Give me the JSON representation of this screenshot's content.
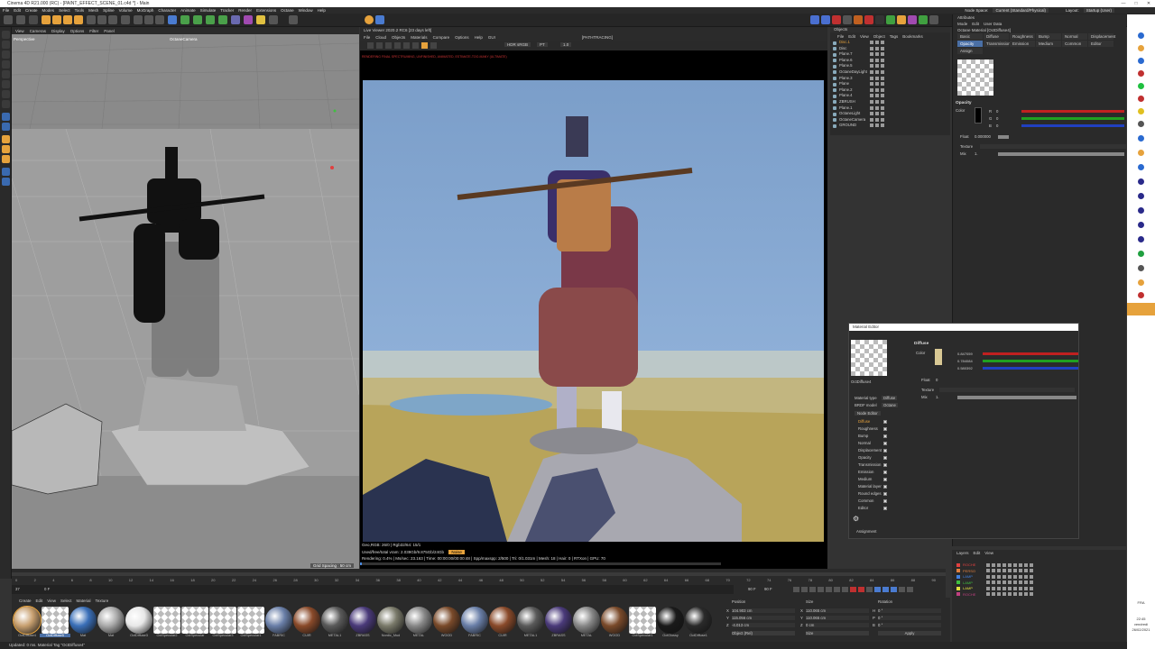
{
  "window": {
    "title": "Cinema 4D R21.000 (RC) - [PAINT_EFFECT_SCENE_01.c4d *] - Main",
    "controls": [
      "—",
      "□",
      "✕"
    ]
  },
  "menubar": {
    "items": [
      "File",
      "Edit",
      "Create",
      "Modes",
      "Select",
      "Tools",
      "Mesh",
      "Spline",
      "Volume",
      "MoGraph",
      "Character",
      "Animate",
      "Simulate",
      "Tracker",
      "Render",
      "Extensions",
      "Octane",
      "Window",
      "Help"
    ],
    "node_space_label": "Node Space:",
    "node_space_value": "Current (Standard/Physical)",
    "layout_label": "Layout:",
    "layout_value": "Startup (User)"
  },
  "viewport": {
    "menu": [
      "View",
      "Cameras",
      "Display",
      "Options",
      "Filter",
      "Panel"
    ],
    "label": "Perspective",
    "camera": "OctaneCamera",
    "grid_spacing": "Grid Spacing : 50 cm"
  },
  "live_viewer": {
    "title": "Live Viewer 2020.2 RC6 [23 days left]",
    "menu": [
      "File",
      "Cloud",
      "Objects",
      "Materials",
      "Compare",
      "Options",
      "Help",
      "GUI"
    ],
    "mode_label": "[PATHTRACING]",
    "hdr_value": "HDR sRGB",
    "pt_value": "PT",
    "zoom_value": "1.0",
    "warning": "RENDERING FINAL SPECTRUMING, UNFINISHED, ANIMATED, ESTIMATE-TOO-MANY (ULTIMATE)",
    "stats": [
      "Geo,RGB: 26/0 | Rgb32/64: 15/1",
      "Used/free/total vram: 2.039Gb/9.875Gb/24Gb",
      "Rendering: 0.4% | Ms/sec: 23.163 | Time: 00:00:00/00:00:48 | Spp/maxspp: 2/500 | Tri: 0/1.031m | Mesh: 18 | Hair: 0 | RTXon | GPU: 70"
    ],
    "noise_label": "Noise",
    "spp_progress": 0.004
  },
  "objects": {
    "title": "Objects",
    "menu": [
      "File",
      "Edit",
      "View",
      "Object",
      "Tags",
      "Bookmarks"
    ],
    "rows": [
      "Disc.1",
      "Disc",
      "Plane.7",
      "Plane.6",
      "Plane.5",
      "OctaneDayLight",
      "Plane.3",
      "Plane",
      "Plane.2",
      "Plane.4",
      "ZBRUSH",
      "Plane.1",
      "OctaneLight",
      "OctaneCamera",
      "GROUND"
    ]
  },
  "attributes": {
    "title": "Attributes",
    "menu": [
      "Mode",
      "Edit",
      "User Data"
    ],
    "material_name": "Octane Material [OctDiffuse4]",
    "tabs": [
      "Basic",
      "Diffuse",
      "Roughness",
      "Bump",
      "Normal",
      "Displacement",
      "Opacity",
      "Transmission",
      "Emission",
      "Medium",
      "Common",
      "Editor",
      "Assign"
    ],
    "active_tab": "Opacity",
    "section": "Opacity",
    "color_label": "Color",
    "rgb_labels": [
      "R",
      "G",
      "B"
    ],
    "rgb_values": [
      "0",
      "0",
      "0"
    ],
    "float_label": "Float",
    "float_value": "0.000000",
    "texture_label": "Texture",
    "mix_label": "Mix",
    "mix_value": "1."
  },
  "material_editor": {
    "title": "Material Editor",
    "material_name": "OctDiffuse4",
    "section": "Diffuse",
    "color_label": "Color",
    "rgb": [
      "0.847059",
      "0.784084",
      "0.580392"
    ],
    "float_label": "Float",
    "float_value": "0",
    "texture_label": "Texture",
    "mix_label": "Mix",
    "mix_value": "1.",
    "material_type_label": "Material type",
    "material_type_value": "Diffuse",
    "brdf_label": "BRDF model",
    "brdf_value": "Octane",
    "node_editor": "Node Editor",
    "channels": [
      "Diffuse",
      "Roughness",
      "Bump",
      "Normal",
      "Displacement",
      "Opacity",
      "Transmission",
      "Emission",
      "Medium",
      "Material layer",
      "Round edges",
      "Common",
      "Editor"
    ],
    "assignment": "Assignment"
  },
  "timeline": {
    "frames": [
      "0",
      "2",
      "4",
      "6",
      "8",
      "10",
      "12",
      "14",
      "16",
      "18",
      "20",
      "22",
      "24",
      "26",
      "28",
      "30",
      "32",
      "34",
      "36",
      "38",
      "40",
      "42",
      "44",
      "46",
      "48",
      "50",
      "52",
      "54",
      "56",
      "58",
      "60",
      "62",
      "64",
      "66",
      "68",
      "70",
      "72",
      "74",
      "76",
      "78",
      "80",
      "82",
      "84",
      "86",
      "88",
      "90"
    ],
    "current": "37",
    "start": "0 F",
    "end": "90 F",
    "end2": "90 F"
  },
  "materials": {
    "menu": [
      "Create",
      "Edit",
      "View",
      "Select",
      "Material",
      "Texture"
    ],
    "items": [
      {
        "label": "OctDiffuse4",
        "color": "#c8a070"
      },
      {
        "label": "OctDiffuse5",
        "color": "checker"
      },
      {
        "label": "Mat",
        "color": "#3a6fb8"
      },
      {
        "label": "Mat",
        "color": "#aaaaaa"
      },
      {
        "label": "OctDiffuse3",
        "color": "#e8e8e8"
      },
      {
        "label": "OctSpecular2",
        "color": "checker"
      },
      {
        "label": "OctSpecular",
        "color": "checker"
      },
      {
        "label": "OctSpecular3",
        "color": "checker"
      },
      {
        "label": "OctSpecular1",
        "color": "checker"
      },
      {
        "label": "FABRIC",
        "color": "#6a7fa8"
      },
      {
        "label": "CUIR",
        "color": "#8a4a2a"
      },
      {
        "label": "METAL1",
        "color": "#5a5a5a"
      },
      {
        "label": "ZBRASS",
        "color": "#4a3a7a"
      },
      {
        "label": "Nordic_Mud",
        "color": "#7a7a6a"
      },
      {
        "label": "METAL",
        "color": "#888888"
      },
      {
        "label": "WOOD",
        "color": "#7a4a2a"
      },
      {
        "label": "FABRIC",
        "color": "#6a7fa8"
      },
      {
        "label": "CUIR",
        "color": "#8a4a2a"
      },
      {
        "label": "METAL1",
        "color": "#5a5a5a"
      },
      {
        "label": "ZBRASS",
        "color": "#4a3a7a"
      },
      {
        "label": "METAL",
        "color": "#888888"
      },
      {
        "label": "WOOD",
        "color": "#7a4a2a"
      },
      {
        "label": "OctSpecular1",
        "color": "checker"
      },
      {
        "label": "OctGlossy",
        "color": "#1a1a1a"
      },
      {
        "label": "OctDiffuse1",
        "color": "#2a2a2a"
      }
    ]
  },
  "coordinates": {
    "headers": [
      "Position",
      "Size",
      "Rotation"
    ],
    "x_pos": "104.903 cm",
    "y_pos": "115.056 cm",
    "z_pos": "-4.013 cm",
    "x_size": "110.065 cm",
    "y_size": "110.065 cm",
    "z_size": "0 cm",
    "h_rot": "0 °",
    "p_rot": "0 °",
    "b_rot": "0 °",
    "mode": "Object (Rel)",
    "size_mode": "Size",
    "apply": "Apply"
  },
  "layers": {
    "menu": [
      "Layers",
      "Edit",
      "View"
    ],
    "rows": [
      {
        "name": "ROCHE",
        "color": "#e04040"
      },
      {
        "name": "PERSO",
        "color": "#e08040"
      },
      {
        "name": "LAMP",
        "color": "#4080e0"
      },
      {
        "name": "LAMP",
        "color": "#40c040"
      },
      {
        "name": "LAMP",
        "color": "#e0e040"
      },
      {
        "name": "ROCHE",
        "color": "#c04080"
      }
    ]
  },
  "status": {
    "text": "Updated: 0 ms.  Material Tag \"OctDiffuse4\""
  },
  "taskbar": {
    "time": "22:45",
    "day": "vendredi",
    "date": "26/02/2021",
    "lang": "FRA"
  }
}
